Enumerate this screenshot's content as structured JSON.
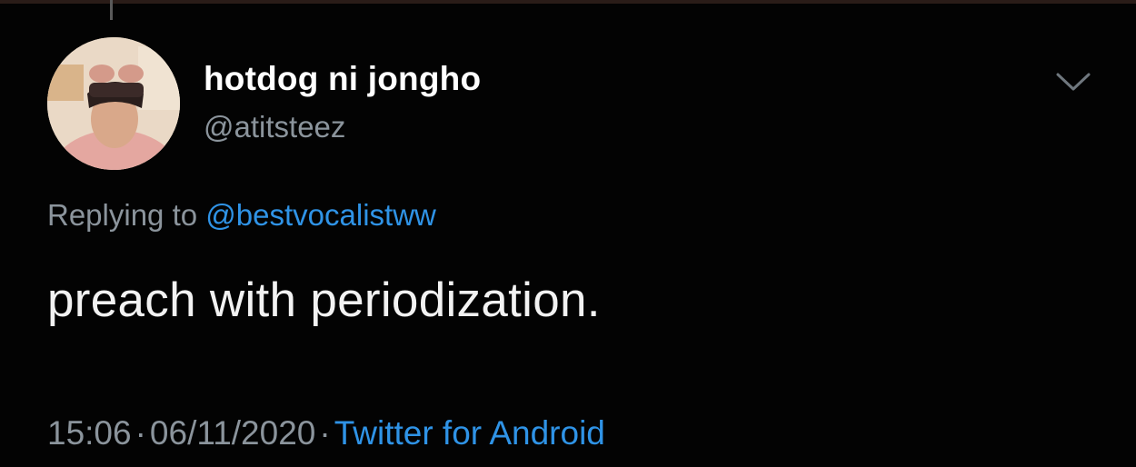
{
  "tweet": {
    "user": {
      "display_name": "hotdog ni jongho",
      "handle": "@atitsteez"
    },
    "reply": {
      "prefix": "Replying to",
      "mention": "@bestvocalistww"
    },
    "text": "preach with periodization.",
    "meta": {
      "time": "15:06",
      "separator": "·",
      "date": "06/11/2020",
      "source": "Twitter for Android"
    },
    "icons": {
      "avatar": "user-avatar-photo",
      "caret": "chevron-down-icon"
    },
    "colors": {
      "background": "#030303",
      "primary_text": "#ffffff",
      "secondary_text": "#8b949c",
      "link": "#2f93e6"
    }
  }
}
